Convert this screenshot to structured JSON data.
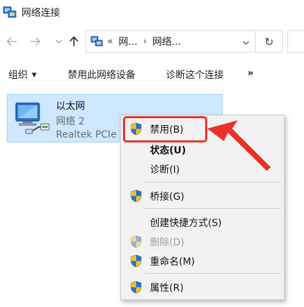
{
  "window": {
    "title": "网络连接"
  },
  "address": {
    "overflow": "«",
    "crumbs": [
      "网...",
      "网络..."
    ],
    "separator": "›",
    "refresh_glyph": "↻"
  },
  "commands": {
    "organize": "组织",
    "disable_device": "禁用此网络设备",
    "diagnose_connection": "诊断这个连接",
    "more": "»"
  },
  "adapter": {
    "name": "以太网",
    "network": "网络 2",
    "device": "Realtek PCIe"
  },
  "context_menu": {
    "items": [
      {
        "label": "禁用(B)",
        "shield": true
      },
      {
        "label": "状态(U)",
        "shield": false,
        "bold": true
      },
      {
        "label": "诊断(I)",
        "shield": false
      },
      {
        "label": "桥接(G)",
        "shield": true
      },
      {
        "label": "创建快捷方式(S)",
        "shield": false
      },
      {
        "label": "删除(D)",
        "shield": true,
        "disabled": true
      },
      {
        "label": "重命名(M)",
        "shield": true
      },
      {
        "label": "属性(R)",
        "shield": true
      }
    ]
  },
  "colors": {
    "selection_fill": "#cde8ff",
    "annotation_red": "#e8322a",
    "menu_bg": "#f2f2f2"
  },
  "icons": [
    "network-connections-icon",
    "back-arrow-icon",
    "forward-arrow-icon",
    "up-arrow-icon",
    "refresh-icon",
    "ethernet-adapter-icon",
    "uac-shield-icon",
    "annotation-arrow-icon"
  ]
}
